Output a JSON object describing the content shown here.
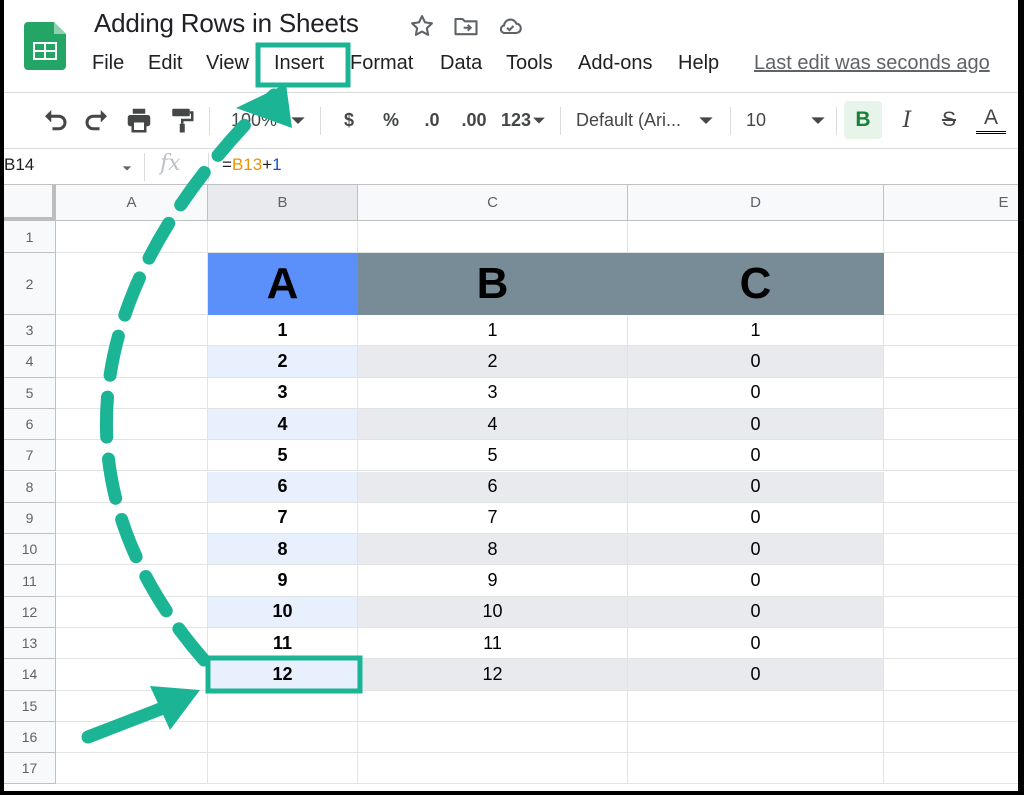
{
  "document": {
    "title": "Adding Rows in Sheets"
  },
  "menu": [
    "File",
    "Edit",
    "View",
    "Insert",
    "Format",
    "Data",
    "Tools",
    "Add-ons",
    "Help"
  ],
  "last_edit": "Last edit was seconds ago",
  "toolbar": {
    "zoom": "100%",
    "currency": "$",
    "percent": "%",
    "decrease_decimal": ".0",
    "increase_decimal": ".00",
    "format_more": "123",
    "font": "Default (Ari...",
    "font_size": "10",
    "bold": "B",
    "italic": "I",
    "strike": "S",
    "text_color": "A"
  },
  "formula_bar": {
    "name_box": "B14",
    "fx": "fx",
    "formula_eq": "=",
    "formula_ref": "B13",
    "formula_op": "+",
    "formula_num": "1"
  },
  "grid": {
    "columns": [
      "A",
      "B",
      "C",
      "D",
      "E"
    ],
    "rows": [
      "1",
      "2",
      "3",
      "4",
      "5",
      "6",
      "7",
      "8",
      "9",
      "10",
      "11",
      "12",
      "13",
      "14",
      "15",
      "16",
      "17"
    ],
    "table_headers": [
      "A",
      "B",
      "C"
    ],
    "table_rows": [
      [
        "1",
        "1",
        "1"
      ],
      [
        "2",
        "2",
        "0"
      ],
      [
        "3",
        "3",
        "0"
      ],
      [
        "4",
        "4",
        "0"
      ],
      [
        "5",
        "5",
        "0"
      ],
      [
        "6",
        "6",
        "0"
      ],
      [
        "7",
        "7",
        "0"
      ],
      [
        "8",
        "8",
        "0"
      ],
      [
        "9",
        "9",
        "0"
      ],
      [
        "10",
        "10",
        "0"
      ],
      [
        "11",
        "11",
        "0"
      ],
      [
        "12",
        "12",
        "0"
      ]
    ]
  },
  "colors": {
    "header_blue": "#5b8ff9",
    "header_slate": "#778c96",
    "band_light": "#e8eaed",
    "band_blue": "#e8f0fe",
    "annotation_green": "#1bb596"
  }
}
